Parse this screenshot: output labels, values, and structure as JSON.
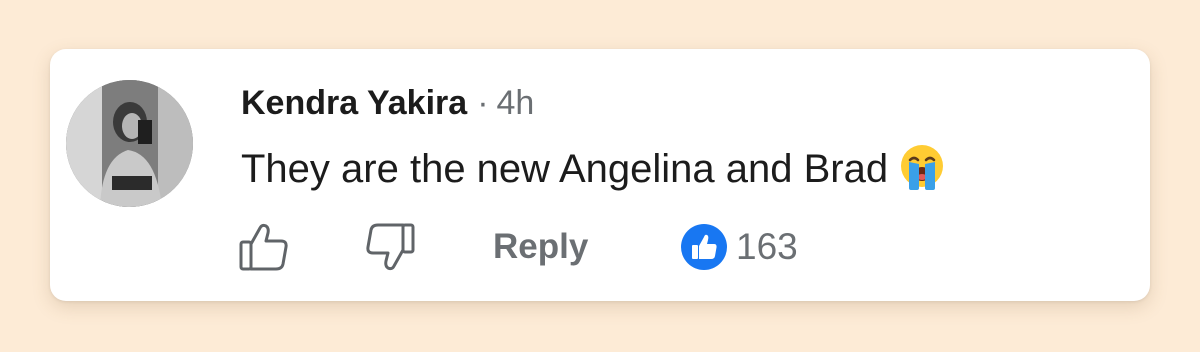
{
  "comment": {
    "author": "Kendra Yakira",
    "separator": "·",
    "time": "4h",
    "text": "They are the new Angelina and Brad",
    "emoji": "loudly-crying-face-icon"
  },
  "actions": {
    "like_icon": "thumbs-up-outline-icon",
    "dislike_icon": "thumbs-down-outline-icon",
    "reply_label": "Reply",
    "reaction_icon": "blue-like-badge-icon",
    "like_count": "163"
  },
  "colors": {
    "background": "#fdebd6",
    "card": "#ffffff",
    "text_primary": "#1c1c1c",
    "text_secondary": "#6b6f73",
    "like_blue": "#1877f2"
  }
}
